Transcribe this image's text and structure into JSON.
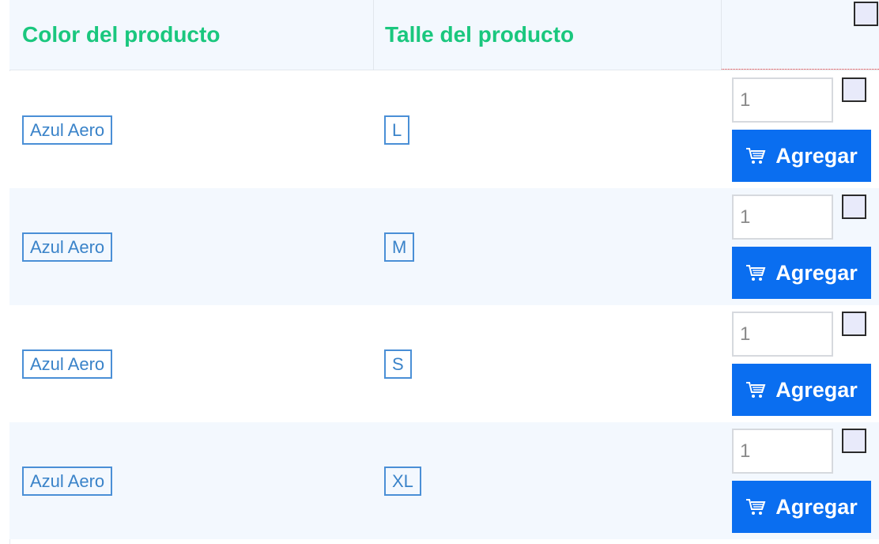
{
  "header": {
    "color_label": "Color del producto",
    "size_label": "Talle del producto"
  },
  "rows": [
    {
      "color": "Azul Aero",
      "size": "L",
      "quantity": "1",
      "button_label": "Agregar"
    },
    {
      "color": "Azul Aero",
      "size": "M",
      "quantity": "1",
      "button_label": "Agregar"
    },
    {
      "color": "Azul Aero",
      "size": "S",
      "quantity": "1",
      "button_label": "Agregar"
    },
    {
      "color": "Azul Aero",
      "size": "XL",
      "quantity": "1",
      "button_label": "Agregar"
    }
  ],
  "icons": {
    "cart": "cart-icon"
  },
  "colors": {
    "header_text": "#1ac77e",
    "tag_border": "#4a8fd6",
    "button_bg": "#0a6ef0",
    "row_alt_bg": "#f3f8fe"
  }
}
